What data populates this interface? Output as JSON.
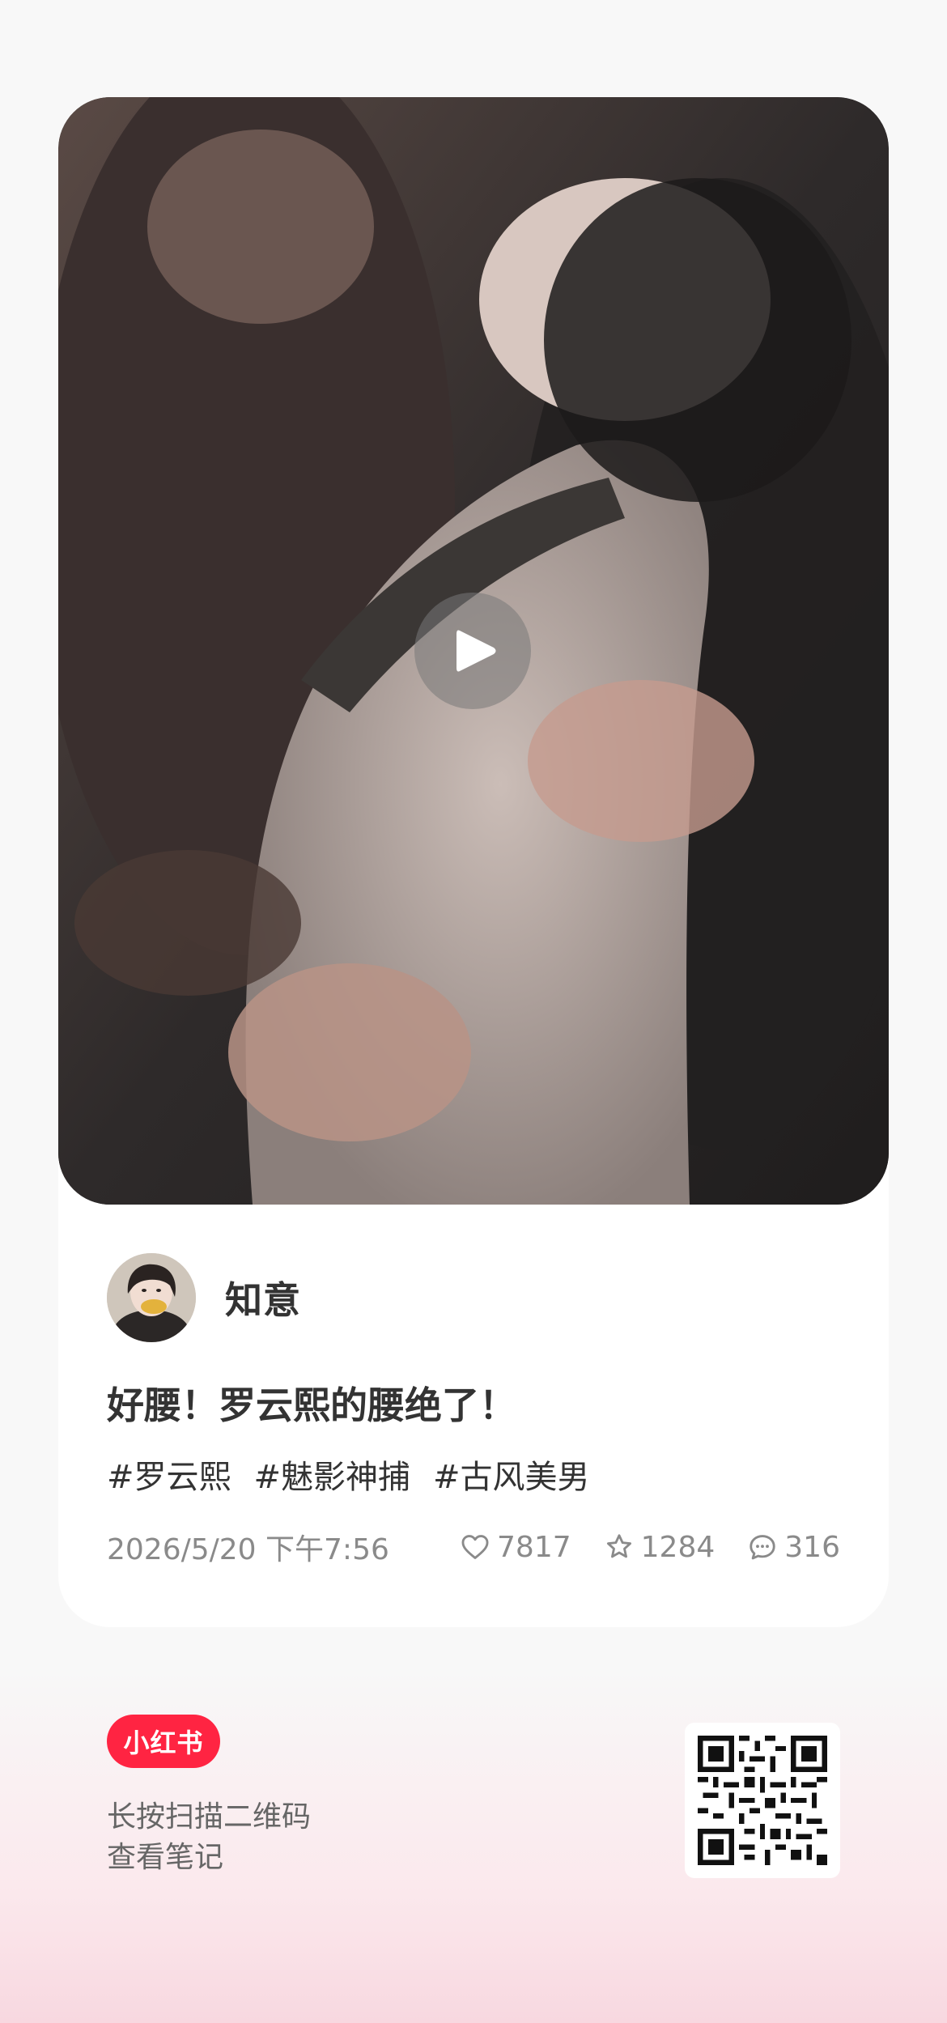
{
  "note": {
    "author": "知意",
    "title": "好腰！罗云熙的腰绝了！",
    "tags": [
      "#罗云熙",
      "#魅影神捕",
      "#古风美男"
    ],
    "datetime": "2026/5/20  下午7:56",
    "likes": "7817",
    "collects": "1284",
    "comments": "316"
  },
  "footer": {
    "brand": "小红书",
    "tip_line1": "长按扫描二维码",
    "tip_line2": "查看笔记"
  },
  "icons": {
    "play": "play-icon",
    "like": "heart-icon",
    "collect": "star-icon",
    "comment": "comment-icon"
  },
  "colors": {
    "brand": "#ff2442",
    "card": "#ffffff",
    "text_primary": "#333333",
    "text_secondary": "#8a8a8a"
  }
}
